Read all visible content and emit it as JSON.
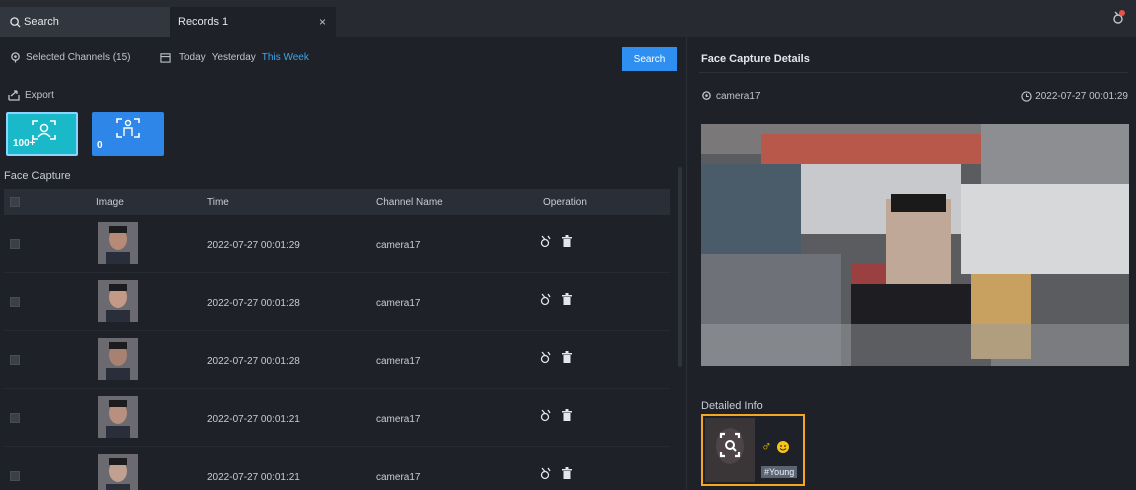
{
  "tabs": {
    "search_label": "Search",
    "records_label": "Records 1",
    "close_glyph": "×"
  },
  "filters": {
    "channels_label": "Selected Channels (15)",
    "date_ranges": [
      "Today",
      "Yesterday",
      "This Week"
    ],
    "active_range": "This Week",
    "search_button": "Search"
  },
  "toolbar": {
    "export_label": "Export"
  },
  "stats": [
    {
      "name": "face",
      "count": "100+",
      "selected": true,
      "color": "#1ab9c9"
    },
    {
      "name": "body",
      "count": "0",
      "selected": false,
      "color": "#2d86e8"
    }
  ],
  "section_title": "Face Capture",
  "table": {
    "columns": [
      "Image",
      "Time",
      "Channel Name",
      "Operation"
    ],
    "rows": [
      {
        "time": "2022-07-27 00:01:29",
        "channel": "camera17"
      },
      {
        "time": "2022-07-27 00:01:28",
        "channel": "camera17"
      },
      {
        "time": "2022-07-27 00:01:28",
        "channel": "camera17"
      },
      {
        "time": "2022-07-27 00:01:21",
        "channel": "camera17"
      },
      {
        "time": "2022-07-27 00:01:21",
        "channel": "camera17"
      }
    ]
  },
  "details": {
    "title": "Face Capture Details",
    "camera": "camera17",
    "timestamp": "2022-07-27 00:01:29",
    "detailed_info_label": "Detailed Info",
    "gender_glyph": "♂",
    "tag": "#Young"
  },
  "colors": {
    "accent": "#2e8ff0",
    "highlight": "#f5a623",
    "active_link": "#3aa7ee"
  }
}
